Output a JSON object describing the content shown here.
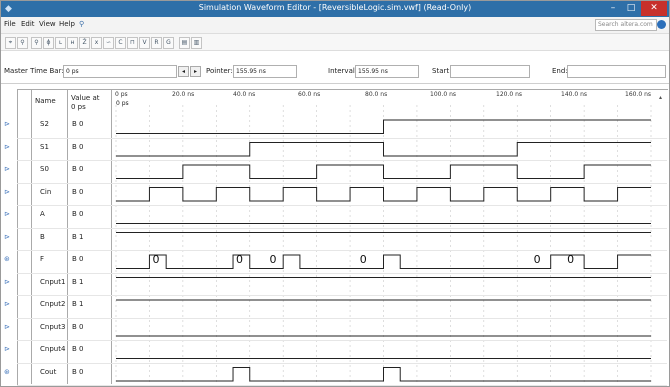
{
  "window": {
    "title": "Simulation Waveform Editor - [ReversibleLogic.sim.vwf] (Read-Only)",
    "minimize": "–",
    "maximize": "□",
    "close": "✕"
  },
  "menu": [
    "File",
    "Edit",
    "View",
    "Help"
  ],
  "search": {
    "placeholder": "Search altera.com"
  },
  "timebar": {
    "master_label": "Master Time Bar:",
    "master_value": "0 ps",
    "pointer_label": "Pointer:",
    "pointer_value": "155.95 ns",
    "interval_label": "Interval:",
    "interval_value": "155.95 ns",
    "start_label": "Start:",
    "start_value": "",
    "end_label": "End:",
    "end_value": ""
  },
  "columns": {
    "name": "Name",
    "value_line1": "Value at",
    "value_line2": "0 ps"
  },
  "time_labels": [
    "0 ps",
    "20.0 ns",
    "40.0 ns",
    "60.0 ns",
    "80.0 ns",
    "100.0 ns",
    "120.0 ns",
    "140.0 ns",
    "160.0 ns"
  ],
  "cursor_label": "0 ps",
  "signals": [
    {
      "name": "S2",
      "value": "B 0",
      "kind": "in"
    },
    {
      "name": "S1",
      "value": "B 0",
      "kind": "in"
    },
    {
      "name": "S0",
      "value": "B 0",
      "kind": "in"
    },
    {
      "name": "Cin",
      "value": "B 0",
      "kind": "in"
    },
    {
      "name": "A",
      "value": "B 0",
      "kind": "in"
    },
    {
      "name": "B",
      "value": "B 1",
      "kind": "in"
    },
    {
      "name": "F",
      "value": "B 0",
      "kind": "out"
    },
    {
      "name": "Cnput1",
      "value": "B 1",
      "kind": "in"
    },
    {
      "name": "Cnput2",
      "value": "B 1",
      "kind": "in"
    },
    {
      "name": "Cnput3",
      "value": "B 0",
      "kind": "in"
    },
    {
      "name": "Cnput4",
      "value": "B 0",
      "kind": "in"
    },
    {
      "name": "Cout",
      "value": "B 0",
      "kind": "out"
    }
  ],
  "waveforms": {
    "S2": [
      [
        0,
        0
      ],
      [
        80,
        1
      ]
    ],
    "S1": [
      [
        0,
        0
      ],
      [
        40,
        1
      ],
      [
        80,
        0
      ],
      [
        120,
        1
      ]
    ],
    "S0": [
      [
        0,
        0
      ],
      [
        20,
        1
      ],
      [
        40,
        0
      ],
      [
        60,
        1
      ],
      [
        80,
        0
      ],
      [
        100,
        1
      ],
      [
        120,
        0
      ],
      [
        140,
        1
      ]
    ],
    "Cin": [
      [
        0,
        0
      ],
      [
        10,
        1
      ],
      [
        20,
        0
      ],
      [
        30,
        1
      ],
      [
        40,
        0
      ],
      [
        50,
        1
      ],
      [
        60,
        0
      ],
      [
        70,
        1
      ],
      [
        80,
        0
      ],
      [
        90,
        1
      ],
      [
        100,
        0
      ],
      [
        110,
        1
      ],
      [
        120,
        0
      ],
      [
        130,
        1
      ],
      [
        140,
        0
      ],
      [
        150,
        1
      ]
    ],
    "A": [
      [
        0,
        0
      ]
    ],
    "B": [
      [
        0,
        1
      ]
    ],
    "F": [
      [
        0,
        0
      ],
      [
        10,
        1
      ],
      [
        15,
        0
      ],
      [
        35,
        1
      ],
      [
        40,
        0
      ],
      [
        50,
        1
      ],
      [
        55,
        0
      ],
      [
        80,
        1
      ],
      [
        85,
        0
      ],
      [
        130,
        1
      ],
      [
        140,
        0
      ],
      [
        150,
        1
      ]
    ],
    "Cnput1": [
      [
        0,
        1
      ]
    ],
    "Cnput2": [
      [
        0,
        1
      ]
    ],
    "Cnput3": [
      [
        0,
        0
      ]
    ],
    "Cnput4": [
      [
        0,
        0
      ]
    ],
    "Cout": [
      [
        0,
        0
      ],
      [
        35,
        1
      ],
      [
        40,
        0
      ],
      [
        80,
        1
      ],
      [
        85,
        0
      ]
    ]
  },
  "f_labels": [
    {
      "t": 10,
      "text": "0"
    },
    {
      "t": 35,
      "text": "0"
    },
    {
      "t": 45,
      "text": "0"
    },
    {
      "t": 72,
      "text": "0"
    },
    {
      "t": 124,
      "text": "0"
    },
    {
      "t": 134,
      "text": "0"
    }
  ],
  "time_max_ns": 160
}
